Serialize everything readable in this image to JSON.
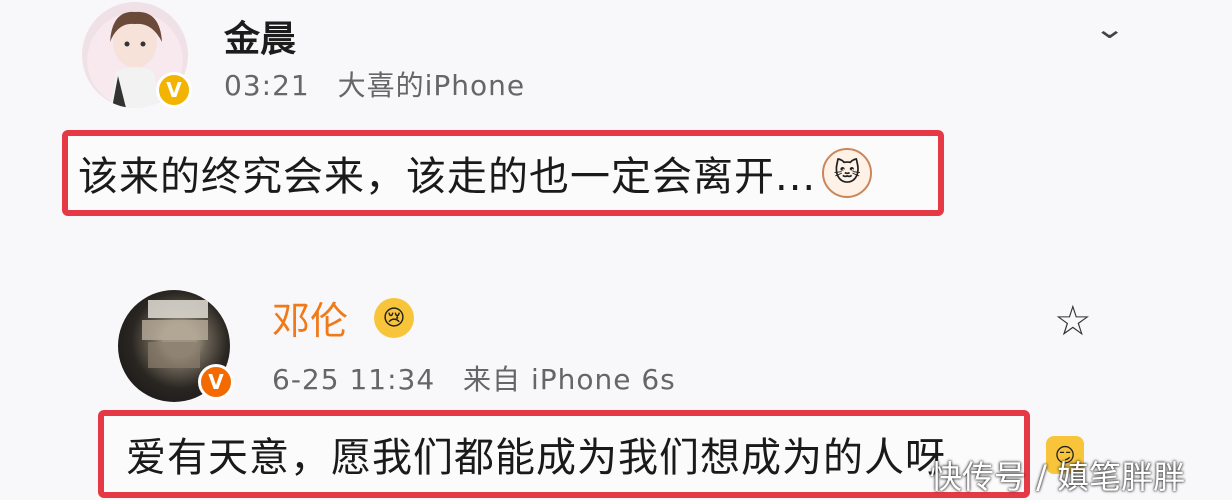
{
  "comment1": {
    "username": "金晨",
    "time": "03:21",
    "device": "大喜的iPhone",
    "text": "该来的终究会来，该走的也一定会离开...",
    "badge": "V",
    "avatar_icon": "avatar-girl",
    "emoji_icon": "cat-emoji",
    "menu_icon": "chevron-down-icon"
  },
  "comment2": {
    "username": "邓伦",
    "date": "6-25 11:34",
    "source": "来自 iPhone 6s",
    "text": "爱有天意，愿我们都能成为我们想成为的人呀",
    "badge": "V",
    "name_emoji_icon": "sad-emoji",
    "action_icon": "star-icon"
  },
  "watermark": "快传号 / 嫃笔胖胖",
  "colors": {
    "highlight_border": "#e53a46",
    "username2": "#f07a19",
    "badge1": "#f2b400",
    "badge2": "#f26a00"
  }
}
